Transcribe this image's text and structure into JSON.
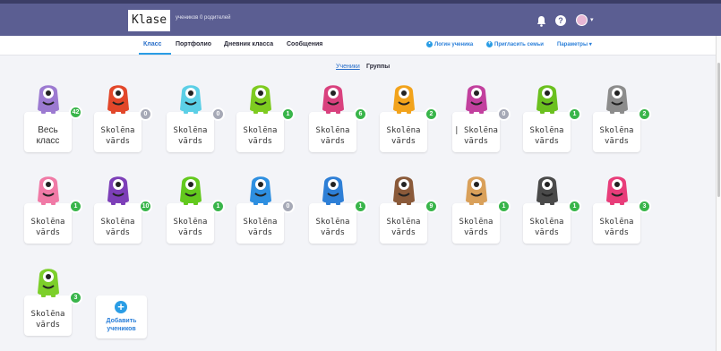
{
  "header": {
    "class_name": "Klase",
    "class_subtitle": "учеников  0 родителей",
    "colors": {
      "bar": "#5b5e92"
    }
  },
  "nav": {
    "tabs": [
      "Класс",
      "Портфолио",
      "Дневник класса",
      "Сообщения"
    ],
    "login_link": "Логин ученика",
    "invite_link": "Пригласить семьи",
    "settings_link": "Параметры ▾"
  },
  "toggle": {
    "students": "Ученики",
    "groups": "Группы"
  },
  "whole_class": {
    "label": "Весь\nкласс",
    "points": "42"
  },
  "students": [
    {
      "name": "Skolēna\nvārds",
      "points": "0",
      "color": "#e2472a"
    },
    {
      "name": "Skolēna\nvārds",
      "points": "0",
      "color": "#5ccfe6"
    },
    {
      "name": "Skolēna\nvārds",
      "points": "1",
      "color": "#7ecb20"
    },
    {
      "name": "Skolēna\nvārds",
      "points": "6",
      "color": "#d9417e"
    },
    {
      "name": "Skolēna\nvārds",
      "points": "2",
      "color": "#f2a31c"
    },
    {
      "name": "| Skolēna\nvārds",
      "points": "0",
      "color": "#c2409e"
    },
    {
      "name": "Skolēna\nvārds",
      "points": "1",
      "color": "#6bc01f"
    },
    {
      "name": "Skolēna\nvārds",
      "points": "2",
      "color": "#8c8c8c"
    },
    {
      "name": "Skolēna\nvārds",
      "points": "1",
      "color": "#f07aa6"
    },
    {
      "name": "Skolēna\nvārds",
      "points": "10",
      "color": "#7d3fb8"
    },
    {
      "name": "Skolēna\nvārds",
      "points": "1",
      "color": "#63c91e"
    },
    {
      "name": "Skolēna\nvārds",
      "points": "0",
      "color": "#2e8fe0"
    },
    {
      "name": "Skolēna\nvārds",
      "points": "1",
      "color": "#2e7fd6"
    },
    {
      "name": "Skolēna\nvārds",
      "points": "9",
      "color": "#8a5a3a"
    },
    {
      "name": "Skolēna\nvārds",
      "points": "1",
      "color": "#d9a05a"
    },
    {
      "name": "Skolēna\nvārds",
      "points": "1",
      "color": "#4a4a4a"
    },
    {
      "name": "Skolēna\nvārds",
      "points": "3",
      "color": "#e83d7a"
    },
    {
      "name": "Skolēna\nvārds",
      "points": "3",
      "color": "#7ccf2a"
    }
  ],
  "add_student": {
    "label": "Добавить\nучеников"
  }
}
